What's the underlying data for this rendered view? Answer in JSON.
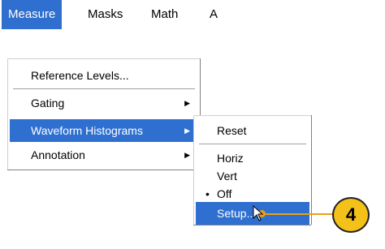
{
  "menubar": {
    "items": [
      {
        "label": "Measure",
        "active": true
      },
      {
        "label": "Masks",
        "active": false
      },
      {
        "label": "Math",
        "active": false
      },
      {
        "label": "A",
        "active": false
      }
    ]
  },
  "measure_menu": {
    "items": [
      {
        "label": "Reference Levels...",
        "has_submenu": false
      },
      {
        "label": "Gating",
        "has_submenu": true
      },
      {
        "label": "Waveform Histograms",
        "has_submenu": true,
        "highlighted": true
      },
      {
        "label": "Annotation",
        "has_submenu": true
      }
    ]
  },
  "histogram_submenu": {
    "items": [
      {
        "label": "Reset"
      },
      {
        "label": "Horiz"
      },
      {
        "label": "Vert"
      },
      {
        "label": "Off",
        "checked": true
      },
      {
        "label": "Setup...",
        "highlighted": true
      }
    ]
  },
  "callout": {
    "number": "4",
    "color": "#f3c11a",
    "line_color": "#e9a016"
  },
  "colors": {
    "highlight": "#2f6fd0"
  }
}
